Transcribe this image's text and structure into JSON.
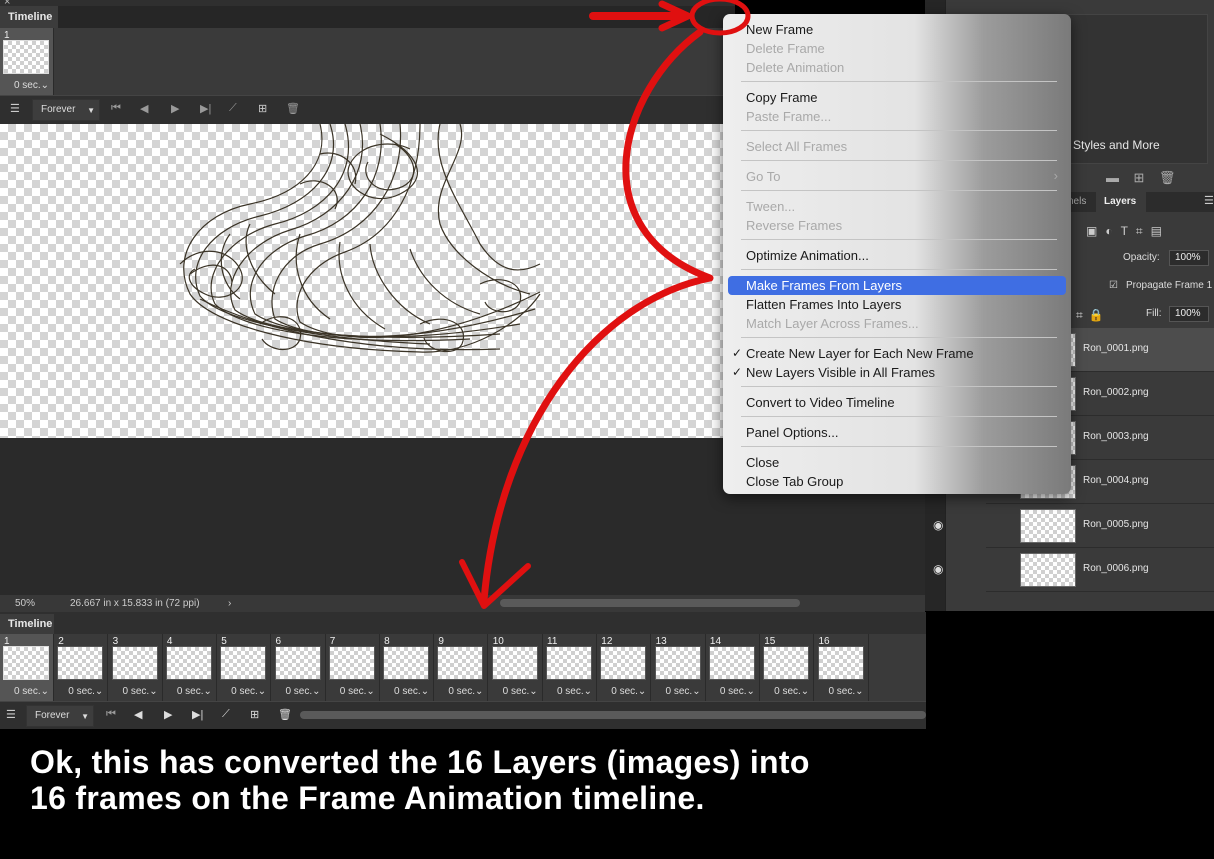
{
  "top_timeline": {
    "tab_label": "Timeline",
    "close_glyph": "×",
    "frame": {
      "number": "1",
      "delay": "0 sec.⌄"
    },
    "loop_option": "Forever"
  },
  "canvas": {
    "zoom": "50%",
    "doc_size": "26.667 in x 15.833 in (72 ppi)",
    "status_arrow": "›"
  },
  "right_panel": {
    "libraries_text": "Styles and More",
    "tabs": {
      "channels": "nels",
      "layers": "Layers"
    },
    "opacity_label": "Opacity:",
    "opacity_value": "100%",
    "propagate_label": "Propagate Frame 1",
    "fill_label": "Fill:",
    "fill_value": "100%",
    "layers": [
      {
        "name": "Ron_0001.png",
        "visible": false,
        "selected": true
      },
      {
        "name": "Ron_0002.png",
        "visible": false,
        "selected": false
      },
      {
        "name": "Ron_0003.png",
        "visible": false,
        "selected": false
      },
      {
        "name": "Ron_0004.png",
        "visible": false,
        "selected": false
      },
      {
        "name": "Ron_0005.png",
        "visible": true,
        "selected": false
      },
      {
        "name": "Ron_0006.png",
        "visible": true,
        "selected": false
      }
    ]
  },
  "menu": {
    "items": [
      {
        "label": "New Frame",
        "enabled": true
      },
      {
        "label": "Delete Frame",
        "enabled": false
      },
      {
        "label": "Delete Animation",
        "enabled": false
      },
      {
        "label": "Copy Frame",
        "enabled": true
      },
      {
        "label": "Paste Frame...",
        "enabled": false
      },
      {
        "label": "Select All Frames",
        "enabled": false
      },
      {
        "label": "Go To",
        "enabled": false,
        "submenu": "›"
      },
      {
        "label": "Tween...",
        "enabled": false
      },
      {
        "label": "Reverse Frames",
        "enabled": false
      },
      {
        "label": "Optimize Animation...",
        "enabled": true
      },
      {
        "label": "Make Frames From Layers",
        "enabled": true,
        "highlighted": true
      },
      {
        "label": "Flatten Frames Into Layers",
        "enabled": true
      },
      {
        "label": "Match Layer Across Frames...",
        "enabled": false
      },
      {
        "label": "Create New Layer for Each New Frame",
        "enabled": true,
        "checked": true
      },
      {
        "label": "New Layers Visible in All Frames",
        "enabled": true,
        "checked": true
      },
      {
        "label": "Convert to Video Timeline",
        "enabled": true
      },
      {
        "label": "Panel Options...",
        "enabled": true
      },
      {
        "label": "Close",
        "enabled": true
      },
      {
        "label": "Close Tab Group",
        "enabled": true
      }
    ],
    "check_glyph": "✓"
  },
  "bottom_timeline": {
    "tab_label": "Timeline",
    "loop_option": "Forever",
    "frames": [
      {
        "number": "1",
        "delay": "0 sec.⌄"
      },
      {
        "number": "2",
        "delay": "0 sec.⌄"
      },
      {
        "number": "3",
        "delay": "0 sec.⌄"
      },
      {
        "number": "4",
        "delay": "0 sec.⌄"
      },
      {
        "number": "5",
        "delay": "0 sec.⌄"
      },
      {
        "number": "6",
        "delay": "0 sec.⌄"
      },
      {
        "number": "7",
        "delay": "0 sec.⌄"
      },
      {
        "number": "8",
        "delay": "0 sec.⌄"
      },
      {
        "number": "9",
        "delay": "0 sec.⌄"
      },
      {
        "number": "10",
        "delay": "0 sec.⌄"
      },
      {
        "number": "11",
        "delay": "0 sec.⌄"
      },
      {
        "number": "12",
        "delay": "0 sec.⌄"
      },
      {
        "number": "13",
        "delay": "0 sec.⌄"
      },
      {
        "number": "14",
        "delay": "0 sec.⌄"
      },
      {
        "number": "15",
        "delay": "0 sec.⌄"
      },
      {
        "number": "16",
        "delay": "0 sec.⌄"
      }
    ]
  },
  "caption": {
    "line1": "Ok, this has converted the 16 Layers (images) into",
    "line2": "16 frames on the Frame Animation timeline."
  },
  "colors": {
    "annotation_red": "#e01010",
    "menu_highlight": "#3f6ee3",
    "panel_bg": "#2f2f2f"
  },
  "icons": [
    "panel-menu-icon",
    "first-frame-icon",
    "prev-frame-icon",
    "play-icon",
    "next-frame-icon",
    "tween-icon",
    "new-frame-icon",
    "trash-icon",
    "eye-icon",
    "timeline-options-icon"
  ]
}
